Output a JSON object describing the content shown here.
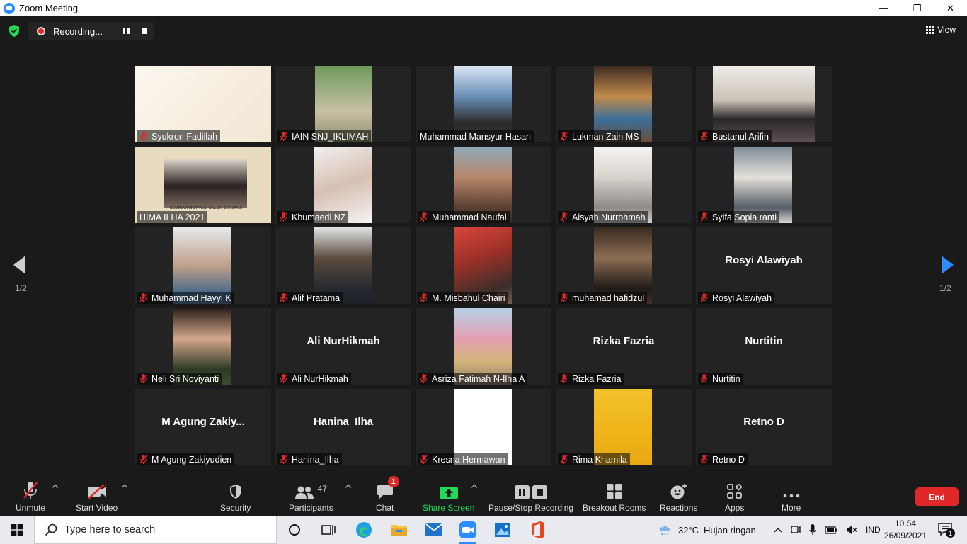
{
  "window": {
    "title": "Zoom Meeting",
    "controls": [
      "—",
      "❐",
      "✕"
    ]
  },
  "top_bar": {
    "recording_label": "Recording...",
    "view_label": "View"
  },
  "gallery": {
    "page_left": "1/2",
    "page_right": "1/2",
    "tiles": [
      {
        "name": "Syukron Fadillah",
        "muted": true
      },
      {
        "name": "IAIN SNJ_IKLIMAH",
        "muted": true
      },
      {
        "name": "Muhammad Mansyur Hasan",
        "muted": false
      },
      {
        "name": "Lukman Zain MS",
        "muted": true
      },
      {
        "name": "Bustanul Arifin",
        "muted": true
      },
      {
        "name": "HIMA ILHA 2021",
        "muted": false
      },
      {
        "name": "Khumaedi NZ",
        "muted": true
      },
      {
        "name": "Muhammad Naufal",
        "muted": true
      },
      {
        "name": "Aisyah Nurrohmah",
        "muted": true
      },
      {
        "name": "Syifa Sopia ranti",
        "muted": true
      },
      {
        "name": "Muhammad Hayyi K",
        "muted": true
      },
      {
        "name": "Alif Pratama",
        "muted": true
      },
      {
        "name": "M. Misbahul Chairi",
        "muted": true
      },
      {
        "name": "muhamad hafidzul",
        "muted": true
      },
      {
        "name": "Rosyi Alawiyah",
        "muted": true,
        "display_name": "Rosyi Alawiyah"
      },
      {
        "name": "Neli Sri Noviyanti",
        "muted": true
      },
      {
        "name": "Ali NurHikmah",
        "muted": true,
        "display_name": "Ali NurHikmah"
      },
      {
        "name": "Asriza Fatimah N-Ilha A",
        "muted": true
      },
      {
        "name": "Rizka Fazria",
        "muted": true,
        "display_name": "Rizka Fazria"
      },
      {
        "name": "Nurtitin",
        "muted": true,
        "display_name": "Nurtitin"
      },
      {
        "name": "M Agung Zakiyudien",
        "muted": true,
        "display_name": "M Agung Zakiy..."
      },
      {
        "name": "Hanina_Ilha",
        "muted": true,
        "display_name": "Hanina_Ilha"
      },
      {
        "name": "Kresna Hermawan",
        "muted": true
      },
      {
        "name": "Rima Khamila",
        "muted": true
      },
      {
        "name": "Retno D",
        "muted": true,
        "display_name": "Retno D"
      }
    ],
    "slide_banner": "SEMINAR MOTIVASI CALON SARJANA"
  },
  "toolbar": {
    "unmute": "Unmute",
    "start_video": "Start Video",
    "security": "Security",
    "participants": "Participants",
    "participants_count": "47",
    "chat": "Chat",
    "chat_badge": "1",
    "share_screen": "Share Screen",
    "pause_stop_recording": "Pause/Stop Recording",
    "breakout_rooms": "Breakout Rooms",
    "reactions": "Reactions",
    "apps": "Apps",
    "more": "More",
    "end": "End"
  },
  "taskbar": {
    "search_placeholder": "Type here to search",
    "weather_temp": "32°C",
    "weather_text": "Hujan ringan",
    "language": "IND",
    "time": "10.54",
    "date": "26/09/2021",
    "notification_count": "1"
  },
  "colors": {
    "zoom_blue": "#2d8cff",
    "end_red": "#e02828",
    "share_green": "#23d959",
    "mute_red": "#e02828",
    "active_speaker": "#ccdd33"
  }
}
